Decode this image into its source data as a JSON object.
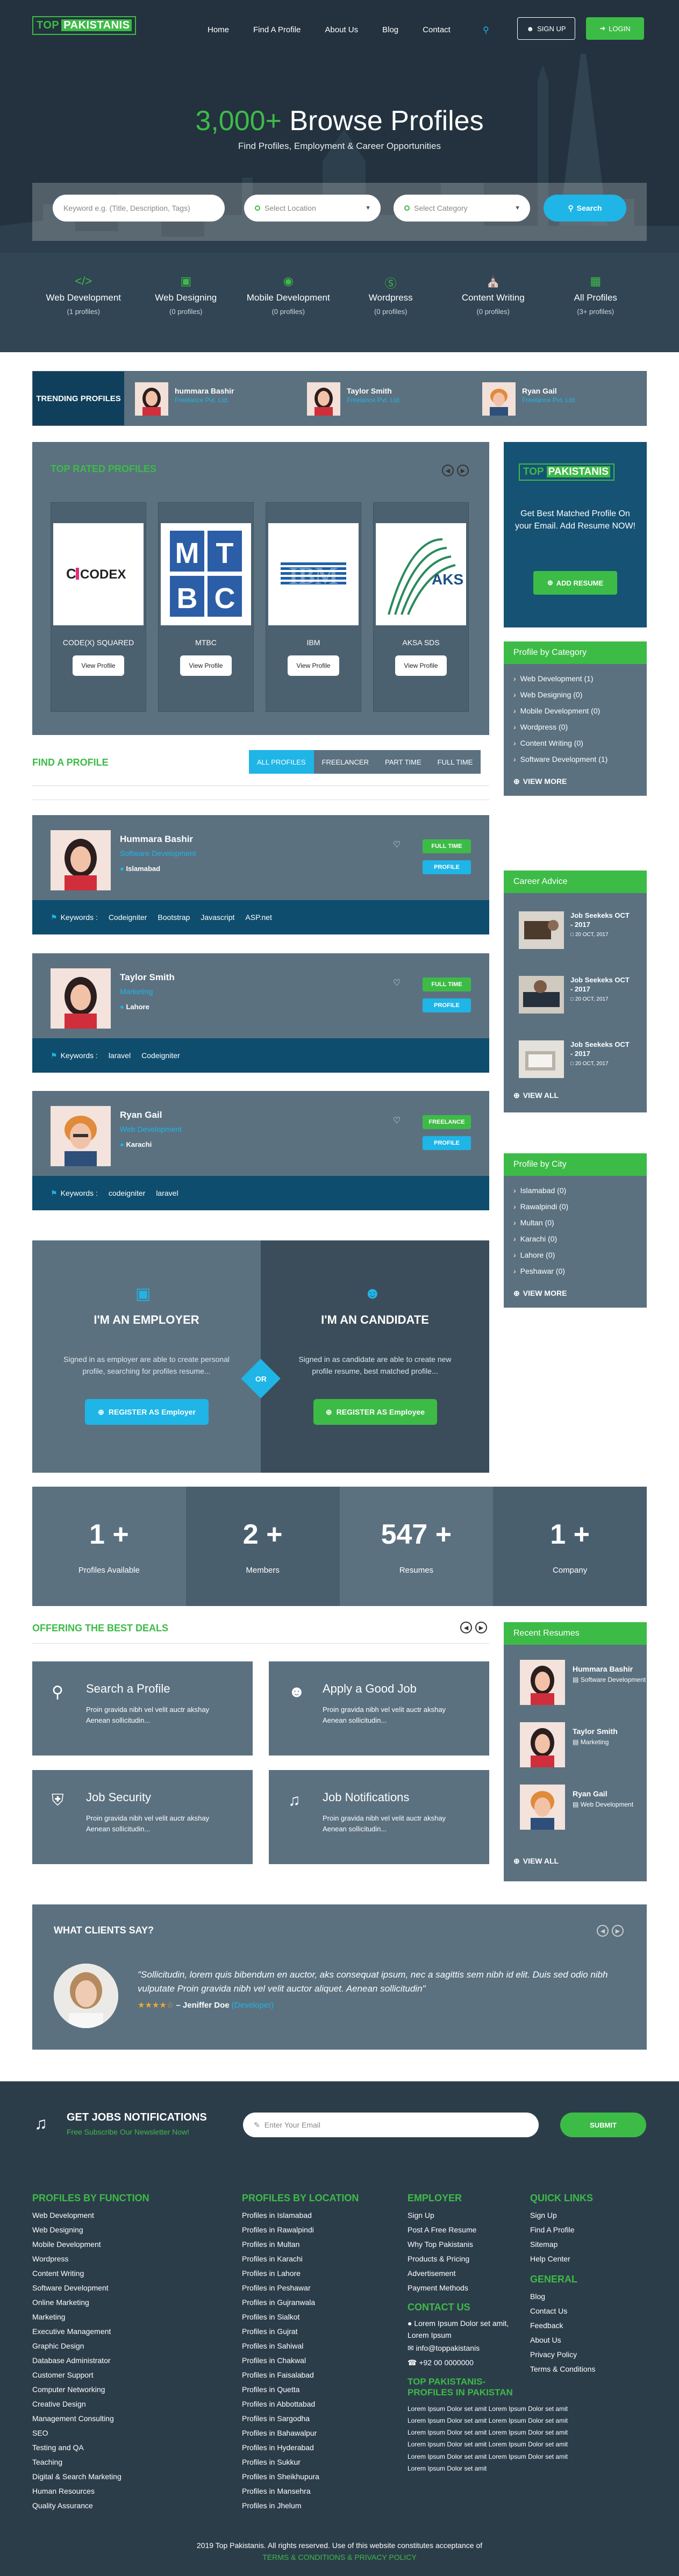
{
  "brand": {
    "part1": "TOP",
    "part2": "PAKISTANIS"
  },
  "nav": {
    "links": [
      "Home",
      "Find A Profile",
      "About Us",
      "Blog",
      "Contact"
    ],
    "signup": "SIGN UP",
    "login": "LOGIN"
  },
  "hero": {
    "title_num": "3,000+",
    "title_rest": "Browse Profiles",
    "subtitle": "Find Profiles, Employment & Career Opportunities"
  },
  "search": {
    "keyword_placeholder": "Keyword e.g. (Title, Description, Tags)",
    "location": "Select Location",
    "category": "Select Category",
    "button": "Search"
  },
  "categories": [
    {
      "icon": "code-icon",
      "name": "Web Development",
      "count": "(1 profiles)"
    },
    {
      "icon": "monitor-icon",
      "name": "Web Designing",
      "count": "(0 profiles)"
    },
    {
      "icon": "android-icon",
      "name": "Mobile Development",
      "count": "(0 profiles)"
    },
    {
      "icon": "wordpress-icon",
      "name": "Wordpress",
      "count": "(0 profiles)"
    },
    {
      "icon": "bank-icon",
      "name": "Content Writing",
      "count": "(0 profiles)"
    },
    {
      "icon": "grid-icon",
      "name": "All Profiles",
      "count": "(3+ profiles)"
    }
  ],
  "trending": {
    "label": "TRENDING PROFILES",
    "items": [
      {
        "name": "hummara Bashir",
        "sub": "Freelance Pvt. Ltd."
      },
      {
        "name": "Taylor Smith",
        "sub": "Freelance Pvt. Ltd."
      },
      {
        "name": "Ryan Gail",
        "sub": "Freelance Pvt. Ltd."
      }
    ]
  },
  "top_rated": {
    "title": "TOP RATED PROFILES",
    "items": [
      {
        "name": "CODE(X) SQUARED",
        "view": "View Profile",
        "logo": "CODEX"
      },
      {
        "name": "MTBC",
        "view": "View Profile",
        "logo": "MTBC"
      },
      {
        "name": "IBM",
        "view": "View Profile",
        "logo": "IBM"
      },
      {
        "name": "AKSA SDS",
        "view": "View Profile",
        "logo": "AKSA"
      }
    ]
  },
  "ad": {
    "brand1": "TOP",
    "brand2": "PAKISTANIS",
    "text": "Get Best Matched Profile On your Email. Add Resume NOW!",
    "button": "ADD RESUME"
  },
  "find": {
    "title": "FIND A PROFILE",
    "tabs": [
      "ALL PROFILES",
      "FREELANCER",
      "PART TIME",
      "FULL TIME"
    ]
  },
  "profiles": [
    {
      "name": "Hummara Bashir",
      "role": "Software Development",
      "loc": "Islamabad",
      "tag": "FULL TIME",
      "tag_color": "#3dbb47",
      "profile": "PROFILE",
      "kw_label": "Keywords :",
      "keywords": [
        "Codeigniter",
        "Bootstrap",
        "Javascript",
        "ASP.net"
      ]
    },
    {
      "name": "Taylor Smith",
      "role": "Marketing",
      "loc": "Lahore",
      "tag": "FULL TIME",
      "tag_color": "#3dbb47",
      "profile": "PROFILE",
      "kw_label": "Keywords :",
      "keywords": [
        "laravel",
        "Codeigniter"
      ]
    },
    {
      "name": "Ryan Gail",
      "role": "Web Development",
      "loc": "Karachi",
      "tag": "FREELANCE",
      "tag_color": "#3dbb47",
      "profile": "PROFILE",
      "kw_label": "Keywords :",
      "keywords": [
        "codeigniter",
        "laravel"
      ]
    }
  ],
  "profile_by_category": {
    "title": "Profile by Category",
    "items": [
      "Web Development (1)",
      "Web Designing (0)",
      "Mobile Development (0)",
      "Wordpress (0)",
      "Content Writing (0)",
      "Software Development (1)"
    ],
    "more": "VIEW MORE"
  },
  "career_advice": {
    "title": "Career Advice",
    "items": [
      {
        "title": "Job Seekeks OCT - 2017",
        "date": "20 OCT, 2017"
      },
      {
        "title": "Job Seekeks OCT - 2017",
        "date": "20 OCT, 2017"
      },
      {
        "title": "Job Seekeks OCT - 2017",
        "date": "20 OCT, 2017"
      }
    ],
    "more": "VIEW ALL"
  },
  "profile_by_city": {
    "title": "Profile by City",
    "items": [
      "Islamabad (0)",
      "Rawalpindi (0)",
      "Multan (0)",
      "Karachi (0)",
      "Lahore (0)",
      "Peshawar (0)"
    ],
    "more": "VIEW MORE"
  },
  "employer": {
    "title": "I'M AN EMPLOYER",
    "desc": "Signed in as employer are able to create personal profile, searching for profiles resume...",
    "button": "REGISTER AS Employer"
  },
  "candidate": {
    "title": "I'M AN CANDIDATE",
    "desc": "Signed in as candidate are able to create new profile resume, best matched profile...",
    "button": "REGISTER AS Employee"
  },
  "or_label": "OR",
  "stats": [
    {
      "num": "1 +",
      "label": "Profiles Available",
      "bg": "#5b7180"
    },
    {
      "num": "2 +",
      "label": "Members",
      "bg": "#4a5f6e"
    },
    {
      "num": "547 +",
      "label": "Resumes",
      "bg": "#5b7180"
    },
    {
      "num": "1 +",
      "label": "Company",
      "bg": "#4a5f6e"
    }
  ],
  "deals": {
    "title": "OFFERING THE BEST DEALS",
    "items": [
      {
        "icon": "search-icon",
        "title": "Search a Profile",
        "desc": "Proin gravida nibh vel velit auctr akshay Aenean sollicitudin..."
      },
      {
        "icon": "user-icon",
        "title": "Apply a Good Job",
        "desc": "Proin gravida nibh vel velit auctr akshay Aenean sollicitudin..."
      },
      {
        "icon": "shield-icon",
        "title": "Job Security",
        "desc": "Proin gravida nibh vel velit auctr akshay Aenean sollicitudin..."
      },
      {
        "icon": "bell-icon",
        "title": "Job Notifications",
        "desc": "Proin gravida nibh vel velit auctr akshay Aenean sollicitudin..."
      }
    ]
  },
  "recent": {
    "title": "Recent Resumes",
    "items": [
      {
        "name": "Hummara Bashir",
        "role": "Software Development"
      },
      {
        "name": "Taylor Smith",
        "role": "Marketing"
      },
      {
        "name": "Ryan Gail",
        "role": "Web Development"
      }
    ],
    "more": "VIEW ALL"
  },
  "testimonial": {
    "title": "WHAT CLIENTS SAY?",
    "quote": "\"Sollicitudin, lorem quis bibendum en auctor, aks consequat ipsum, nec a sagittis sem nibh id elit. Duis sed odio nibh vulputate Proin gravida nibh vel velit auctor aliquet. Aenean sollicitudin\"",
    "stars": "★★★★☆",
    "author": "– Jeniffer Doe",
    "company": "(Developer)"
  },
  "newsletter": {
    "title": "GET JOBS NOTIFICATIONS",
    "sub": "Free Subscribe Our Newsletter Now!",
    "placeholder": "Enter Your Email",
    "button": "SUBMIT"
  },
  "footer": {
    "by_function": {
      "title": "PROFILES BY FUNCTION",
      "items": [
        "Web Development",
        "Web Designing",
        "Mobile Development",
        "Wordpress",
        "Content Writing",
        "Software Development",
        "Online Marketing",
        "Marketing",
        "Executive Management",
        "Graphic Design",
        "Database Administrator",
        "Customer Support",
        "Computer Networking",
        "Creative Design",
        "Management Consulting",
        "SEO",
        "Testing and QA",
        "Teaching",
        "Digital & Search Marketing",
        "Human Resources",
        "Quality Assurance"
      ]
    },
    "by_location": {
      "title": "PROFILES BY LOCATION",
      "items": [
        "Profiles in Islamabad",
        "Profiles in Rawalpindi",
        "Profiles in Multan",
        "Profiles in Karachi",
        "Profiles in Lahore",
        "Profiles in Peshawar",
        "Profiles in Gujranwala",
        "Profiles in Sialkot",
        "Profiles in Gujrat",
        "Profiles in Sahiwal",
        "Profiles in Chakwal",
        "Profiles in Faisalabad",
        "Profiles in Quetta",
        "Profiles in Abbottabad",
        "Profiles in Sargodha",
        "Profiles in Bahawalpur",
        "Profiles in Hyderabad",
        "Profiles in Sukkur",
        "Profiles in Sheikhupura",
        "Profiles in Mansehra",
        "Profiles in Jhelum"
      ]
    },
    "employer": {
      "title": "EMPLOYER",
      "items": [
        "Sign Up",
        "Post A Free Resume",
        "Why Top Pakistanis",
        "Products & Pricing",
        "Advertisement",
        "Payment Methods"
      ]
    },
    "contact": {
      "title": "CONTACT US",
      "address": "Lorem Ipsum Dolor set amit, Lorem Ipsum",
      "email": "info@toppakistanis",
      "phone": "+92 00 0000000"
    },
    "profiles_in": {
      "title": "TOP PAKISTANIS- PROFILES IN PAKISTAN",
      "text": "Lorem Ipsum Dolor set amit Lorem Ipsum Dolor set amit Lorem Ipsum Dolor set amit Lorem Ipsum Dolor set amit Lorem Ipsum Dolor set amit Lorem Ipsum Dolor set amit Lorem Ipsum Dolor set amit Lorem Ipsum Dolor set amit Lorem Ipsum Dolor set amit Lorem Ipsum Dolor set amit Lorem Ipsum Dolor set amit"
    },
    "quick": {
      "title": "QUICK LINKS",
      "items": [
        "Sign Up",
        "Find A Profile",
        "Sitemap",
        "Help Center"
      ]
    },
    "general": {
      "title": "GENERAL",
      "items": [
        "Blog",
        "Contact Us",
        "Feedback",
        "About Us",
        "Privacy Policy",
        "Terms & Conditions"
      ]
    },
    "copyright": "2019 Top Pakistanis. All rights reserved. Use of this website constitutes acceptance of",
    "terms": "TERMS & CONDITIONS & PRIVACY POLICY"
  }
}
